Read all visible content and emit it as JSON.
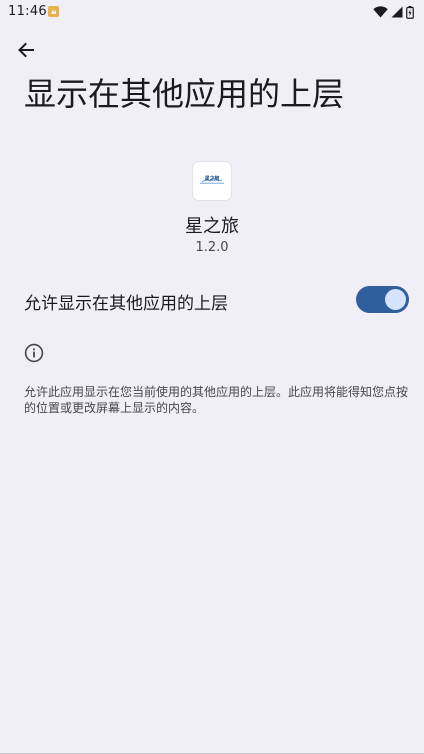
{
  "status_bar": {
    "time": "11:46",
    "icons": [
      "app-notification-icon",
      "wifi-icon",
      "cell-signal-icon",
      "battery-icon"
    ]
  },
  "header": {
    "back_icon": "arrow-back-icon",
    "title": "显示在其他应用的上层"
  },
  "app": {
    "name": "星之旅",
    "version": "1.2.0",
    "icon_text": "星之旅"
  },
  "setting": {
    "label": "允许显示在其他应用的上层",
    "enabled": true
  },
  "info": {
    "icon": "info-icon",
    "description": "允许此应用显示在您当前使用的其他应用的上层。此应用将能得知您点按的位置或更改屏幕上显示的内容。"
  },
  "colors": {
    "background": "#f0eff5",
    "toggle_track": "#2f5f9c",
    "toggle_thumb": "#d6e3ff",
    "notification_icon": "#e6b24a"
  }
}
